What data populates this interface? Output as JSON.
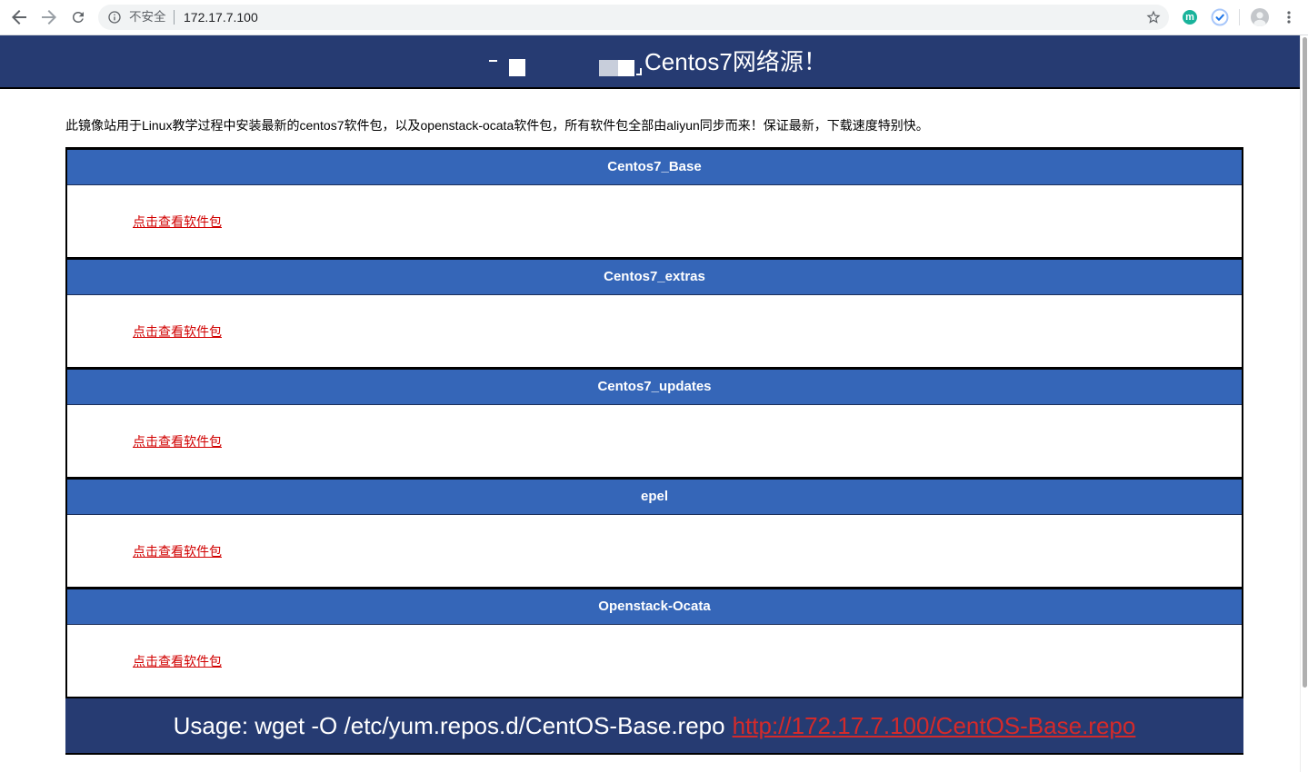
{
  "browser": {
    "security_label": "不安全",
    "url": "172.17.7.100",
    "extension_letter": "m",
    "icons": {
      "back": "back-arrow-icon",
      "forward": "forward-arrow-icon",
      "reload": "reload-icon",
      "site_info": "info-icon",
      "bookmark": "star-icon",
      "extension_1": "m-letter-icon",
      "extension_2": "check-circle-icon",
      "profile": "avatar-icon",
      "menu": "more-vert-icon"
    }
  },
  "page": {
    "title": "Centos7网络源！",
    "intro": "此镜像站用于Linux教学过程中安装最新的centos7软件包，以及openstack-ocata软件包，所有软件包全部由aliyun同步而来！保证最新，下载速度特别快。",
    "repos": [
      {
        "name": "Centos7_Base",
        "link_label": "点击查看软件包"
      },
      {
        "name": "Centos7_extras",
        "link_label": "点击查看软件包"
      },
      {
        "name": "Centos7_updates",
        "link_label": "点击查看软件包"
      },
      {
        "name": "epel",
        "link_label": "点击查看软件包"
      },
      {
        "name": "Openstack-Ocata",
        "link_label": "点击查看软件包"
      }
    ],
    "footer": {
      "usage": "Usage: wget -O /etc/yum.repos.d/CentOS-Base.repo",
      "link_text": "http://172.17.7.100/CentOS-Base.repo"
    }
  },
  "colors": {
    "banner_navy": "#263b72",
    "section_blue": "#3566b8",
    "link_red": "#d10000",
    "footer_link_red": "#d42a2a"
  }
}
